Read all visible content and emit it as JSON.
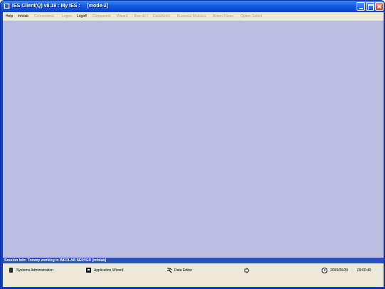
{
  "window": {
    "title": "IES Client(Q) v8.19 : My IES :     [mode-2]"
  },
  "menubar": {
    "items": [
      {
        "label": "Help",
        "enabled": true
      },
      {
        "label": "Infolab",
        "enabled": true
      },
      {
        "label": "Connections",
        "enabled": false
      },
      {
        "label": "Logon",
        "enabled": false
      },
      {
        "label": "Logoff",
        "enabled": true
      },
      {
        "label": "Companion",
        "enabled": false
      },
      {
        "label": "Wizard",
        "enabled": false
      },
      {
        "label": "How do I",
        "enabled": false
      },
      {
        "label": "DataMeets",
        "enabled": false
      },
      {
        "label": "Business Modules",
        "enabled": false
      },
      {
        "label": "Action Focus",
        "enabled": false
      },
      {
        "label": "Option Select",
        "enabled": false
      }
    ]
  },
  "session": {
    "text": "Session Info: Tommy working in INFOLAB SERVER  [infolab]"
  },
  "statusbar": {
    "items": [
      {
        "label": "Systems Administration",
        "icon": "server-icon"
      },
      {
        "label": "Application Wizard",
        "icon": "wizard-window-icon"
      },
      {
        "label": "Data Editor",
        "icon": "data-editor-icon"
      },
      {
        "label": "",
        "icon": "return-arrow-icon"
      }
    ],
    "date": "2009/06/20",
    "time": "09:00:40"
  },
  "colors": {
    "titlebar": "#0a4fd8",
    "workspace": "#bcbce0",
    "session_bar": "#2a4fc4",
    "chrome": "#ece9d8"
  }
}
